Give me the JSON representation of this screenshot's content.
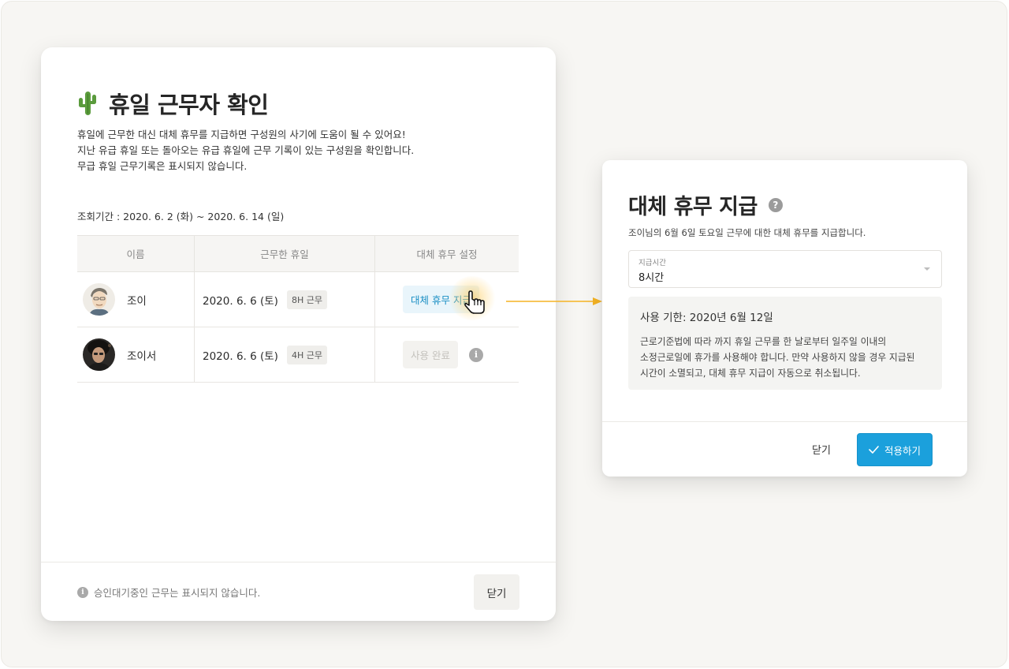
{
  "left_modal": {
    "title": "휴일 근무자 확인",
    "title_icon": "cactus-icon",
    "description": [
      "휴일에 근무한 대신 대체 휴무를 지급하면 구성원의 사기에 도움이 될 수 있어요!",
      "지난 유급 휴일 또는 돌아오는 유급 휴일에 근무 기록이 있는 구성원을 확인합니다.",
      "무급 휴일 근무기록은 표시되지 않습니다."
    ],
    "period": "조회기간 : 2020. 6. 2 (화) ~ 2020. 6. 14 (일)",
    "table": {
      "headers": [
        "이름",
        "근무한 휴일",
        "대체 휴무 설정"
      ],
      "rows": [
        {
          "name": "조이",
          "date": "2020. 6. 6 (토)",
          "hours": "8H 근무",
          "action": "대체 휴무 지급"
        },
        {
          "name": "조이서",
          "date": "2020. 6. 6 (토)",
          "hours": "4H 근무",
          "action": "사용 완료"
        }
      ]
    },
    "footer_note": "승인대기중인 근무는 표시되지 않습니다.",
    "close_label": "닫기"
  },
  "right_modal": {
    "title": "대체 휴무 지급",
    "subtitle": "조이님의 6월 6일 토요일 근무에 대한 대체 휴무를 지급합니다.",
    "select": {
      "label": "지급시간",
      "value": "8시간"
    },
    "deadline": "사용 기한: 2020년 6월 12일",
    "panel_lines": [
      "근로기준법에 따라 까지 휴일 근무를 한 날로부터 일주일 이내의",
      "소정근로일에 휴가를 사용해야 합니다. 만약 사용하지 않을 경우 지급된",
      "시간이 소멸되고, 대체 휴무 지급이 자동으로 취소됩니다."
    ],
    "close_label": "닫기",
    "apply_label": "적용하기"
  },
  "colors": {
    "accent": "#1ba0dc",
    "accent_soft_bg": "#e9f5fb",
    "connector": "#f5b323",
    "page_bg": "#f7f6f3"
  }
}
